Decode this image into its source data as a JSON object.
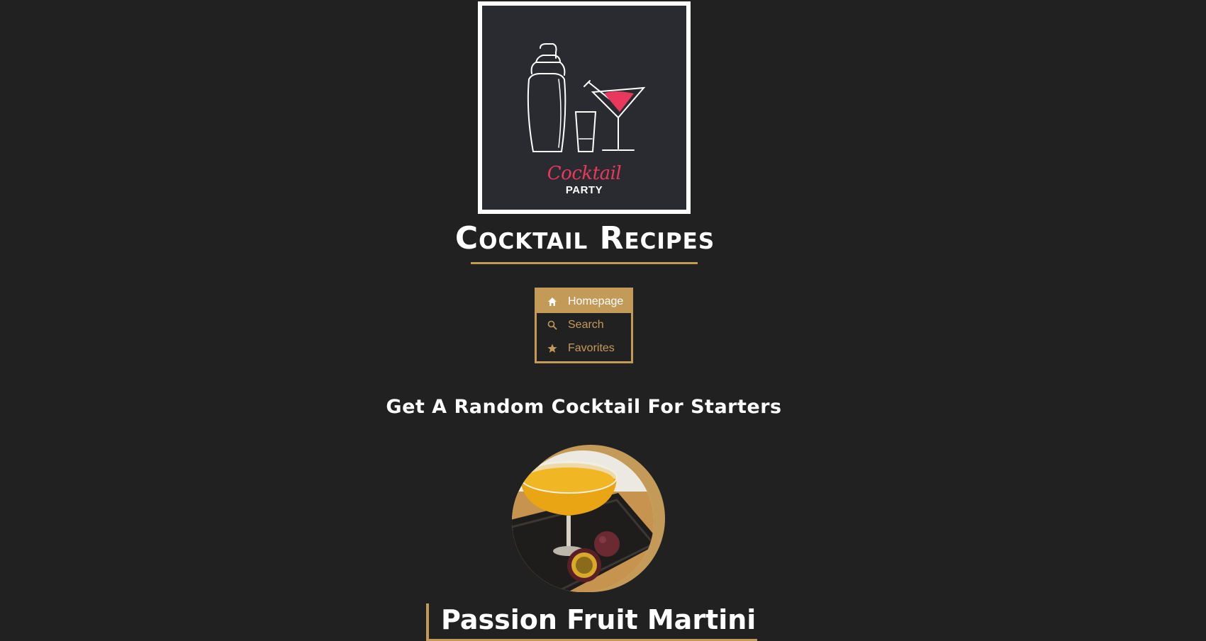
{
  "logo": {
    "brand_script": "Cocktail",
    "brand_word": "PARTY",
    "accent_color": "#e8395d"
  },
  "header": {
    "title": "Cocktail Recipes",
    "underline_color": "#c49a58"
  },
  "nav": {
    "items": [
      {
        "label": "Homepage",
        "icon": "home-icon",
        "active": true
      },
      {
        "label": "Search",
        "icon": "search-icon",
        "active": false
      },
      {
        "label": "Favorites",
        "icon": "star-icon",
        "active": false
      }
    ],
    "accent_color": "#c49a58"
  },
  "main": {
    "subheading": "Get A Random Cocktail For Starters",
    "cocktail": {
      "name": "Passion Fruit Martini"
    }
  },
  "colors": {
    "background": "#212121",
    "gold": "#c49a58",
    "text": "#ffffff"
  }
}
